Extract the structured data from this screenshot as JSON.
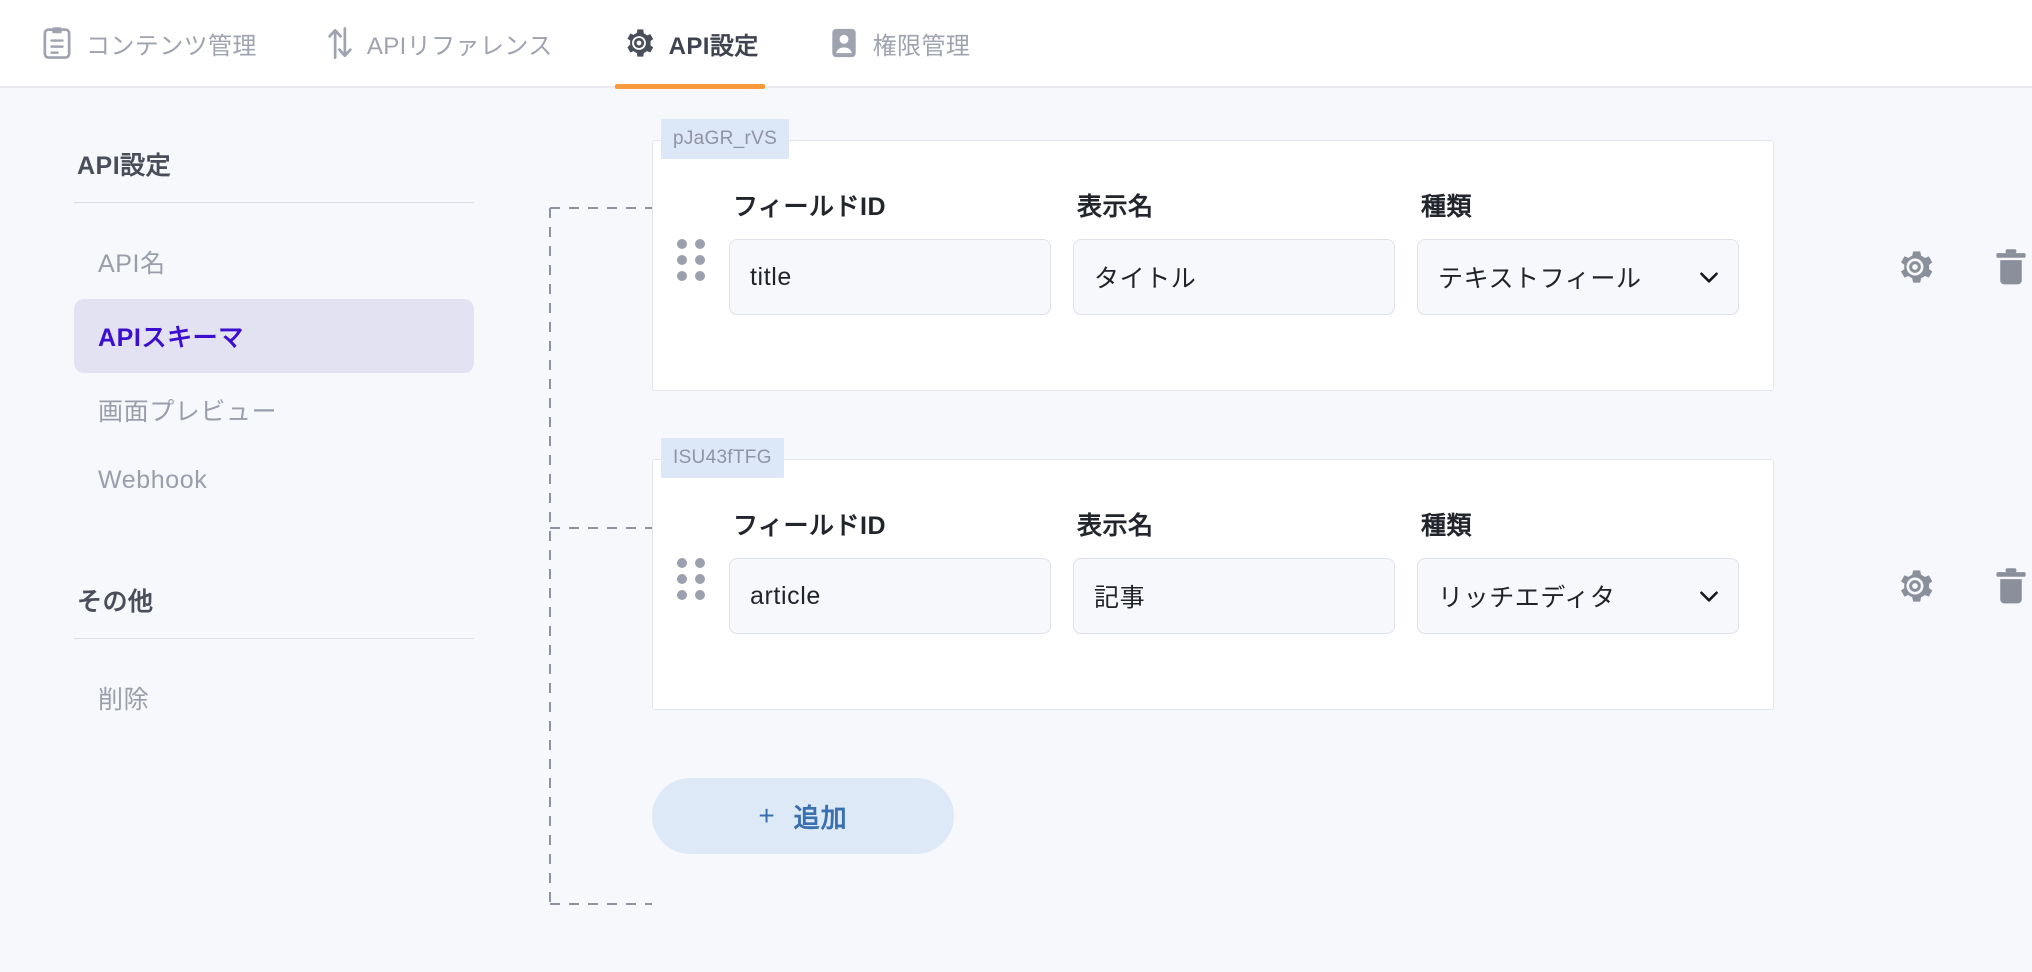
{
  "topbar": {
    "tabs": [
      {
        "label": "コンテンツ管理",
        "icon": "clipboard-icon",
        "active": false
      },
      {
        "label": "APIリファレンス",
        "icon": "sort-arrows-icon",
        "active": false
      },
      {
        "label": "API設定",
        "icon": "gear-icon",
        "active": true
      },
      {
        "label": "権限管理",
        "icon": "user-badge-icon",
        "active": false
      }
    ],
    "active_underline_color": "#f89a3c"
  },
  "sidebar": {
    "sections": [
      {
        "heading": "API設定",
        "items": [
          {
            "label": "API名",
            "active": false
          },
          {
            "label": "APIスキーマ",
            "active": true
          },
          {
            "label": "画面プレビュー",
            "active": false
          },
          {
            "label": "Webhook",
            "active": false
          }
        ]
      },
      {
        "heading": "その他",
        "items": [
          {
            "label": "削除",
            "active": false
          }
        ]
      }
    ],
    "active_bg": "#e3e2f3",
    "active_color": "#3d0ed0"
  },
  "main": {
    "column_headers": {
      "field_id": "フィールドID",
      "display_name": "表示名",
      "kind": "種類"
    },
    "fields": [
      {
        "id_badge": "pJaGR_rVS",
        "field_id": "title",
        "display_name": "タイトル",
        "kind": "テキストフィール",
        "kind_truncated": true,
        "settings_icon": "gear-icon",
        "delete_icon": "trash-icon",
        "drag_handle_icon": "drag-handle-icon"
      },
      {
        "id_badge": "ISU43fTFG",
        "field_id": "article",
        "display_name": "記事",
        "kind": "リッチエディタ",
        "kind_truncated": false,
        "settings_icon": "gear-icon",
        "delete_icon": "trash-icon",
        "drag_handle_icon": "drag-handle-icon"
      }
    ],
    "add_button": {
      "plus": "+",
      "label": "追加"
    }
  }
}
